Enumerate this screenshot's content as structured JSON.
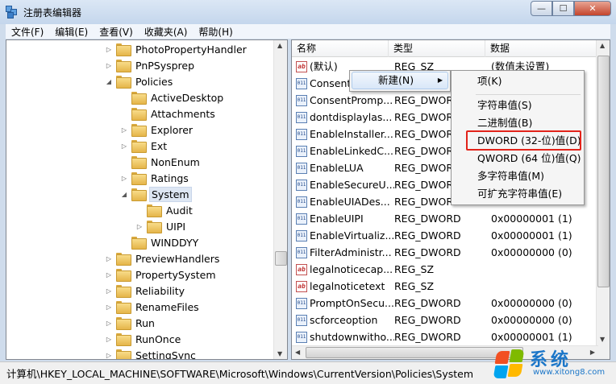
{
  "window": {
    "title": "注册表编辑器",
    "min_glyph": "—",
    "max_glyph": "☐",
    "close_glyph": "✕"
  },
  "menu": [
    "文件(F)",
    "编辑(E)",
    "查看(V)",
    "收藏夹(A)",
    "帮助(H)"
  ],
  "tree": [
    {
      "label": "PhotoPropertyHandler",
      "expander": "▷",
      "level": 1
    },
    {
      "label": "PnPSysprep",
      "expander": "▷",
      "level": 1
    },
    {
      "label": "Policies",
      "expander": "◢",
      "level": 1
    },
    {
      "label": "ActiveDesktop",
      "expander": "",
      "level": 2
    },
    {
      "label": "Attachments",
      "expander": "",
      "level": 2
    },
    {
      "label": "Explorer",
      "expander": "▷",
      "level": 2
    },
    {
      "label": "Ext",
      "expander": "▷",
      "level": 2
    },
    {
      "label": "NonEnum",
      "expander": "",
      "level": 2
    },
    {
      "label": "Ratings",
      "expander": "▷",
      "level": 2
    },
    {
      "label": "System",
      "expander": "◢",
      "level": 2,
      "selected": true
    },
    {
      "label": "Audit",
      "expander": "",
      "level": 3
    },
    {
      "label": "UIPI",
      "expander": "▷",
      "level": 3
    },
    {
      "label": "WINDDYY",
      "expander": "",
      "level": 2
    },
    {
      "label": "PreviewHandlers",
      "expander": "▷",
      "level": 1
    },
    {
      "label": "PropertySystem",
      "expander": "▷",
      "level": 1
    },
    {
      "label": "Reliability",
      "expander": "▷",
      "level": 1
    },
    {
      "label": "RenameFiles",
      "expander": "▷",
      "level": 1
    },
    {
      "label": "Run",
      "expander": "▷",
      "level": 1
    },
    {
      "label": "RunOnce",
      "expander": "▷",
      "level": 1
    },
    {
      "label": "SettingSync",
      "expander": "▷",
      "level": 1
    }
  ],
  "list": {
    "columns": [
      "名称",
      "类型",
      "数据"
    ],
    "rows": [
      {
        "name": "(默认)",
        "kind": "str",
        "type": "REG_SZ",
        "data": "(数值未设置)"
      },
      {
        "name": "Consent",
        "kind": "bin",
        "type": "",
        "data": ""
      },
      {
        "name": "ConsentPromp...",
        "kind": "bin",
        "type": "REG_DWORD",
        "data": ""
      },
      {
        "name": "dontdisplaylas...",
        "kind": "bin",
        "type": "REG_DWORD",
        "data": ""
      },
      {
        "name": "EnableInstaller...",
        "kind": "bin",
        "type": "REG_DWORD",
        "data": ""
      },
      {
        "name": "EnableLinkedC...",
        "kind": "bin",
        "type": "REG_DWORD",
        "data": ""
      },
      {
        "name": "EnableLUA",
        "kind": "bin",
        "type": "REG_DWORD",
        "data": ""
      },
      {
        "name": "EnableSecureU...",
        "kind": "bin",
        "type": "REG_DWORD",
        "data": ""
      },
      {
        "name": "EnableUIADes...",
        "kind": "bin",
        "type": "REG_DWORD",
        "data": ""
      },
      {
        "name": "EnableUIPI",
        "kind": "bin",
        "type": "REG_DWORD",
        "data": "0x00000001 (1)"
      },
      {
        "name": "EnableVirtualiz...",
        "kind": "bin",
        "type": "REG_DWORD",
        "data": "0x00000001 (1)"
      },
      {
        "name": "FilterAdministr...",
        "kind": "bin",
        "type": "REG_DWORD",
        "data": "0x00000000 (0)"
      },
      {
        "name": "legalnoticecap...",
        "kind": "str",
        "type": "REG_SZ",
        "data": ""
      },
      {
        "name": "legalnoticetext",
        "kind": "str",
        "type": "REG_SZ",
        "data": ""
      },
      {
        "name": "PromptOnSecu...",
        "kind": "bin",
        "type": "REG_DWORD",
        "data": "0x00000000 (0)"
      },
      {
        "name": "scforceoption",
        "kind": "bin",
        "type": "REG_DWORD",
        "data": "0x00000000 (0)"
      },
      {
        "name": "shutdownwitho...",
        "kind": "bin",
        "type": "REG_DWORD",
        "data": "0x00000001 (1)"
      }
    ]
  },
  "icons": {
    "string_value": "ab",
    "dword_value": "011"
  },
  "context_menu": {
    "new_label": "新建(N)",
    "arrow": "▶"
  },
  "submenu": [
    {
      "label": "项(K)"
    },
    {
      "label": "字符串值(S)"
    },
    {
      "label": "二进制值(B)"
    },
    {
      "label": "DWORD (32-位)值(D)",
      "highlight": true
    },
    {
      "label": "QWORD (64 位)值(Q)"
    },
    {
      "label": "多字符串值(M)"
    },
    {
      "label": "可扩充字符串值(E)"
    }
  ],
  "status": "计算机\\HKEY_LOCAL_MACHINE\\SOFTWARE\\Microsoft\\Windows\\CurrentVersion\\Policies\\System",
  "watermark": {
    "title": "系统",
    "url": "www.xitong8.com"
  },
  "colors": {
    "highlight_box": "#e2231a",
    "watermark": "#1b76c8"
  }
}
